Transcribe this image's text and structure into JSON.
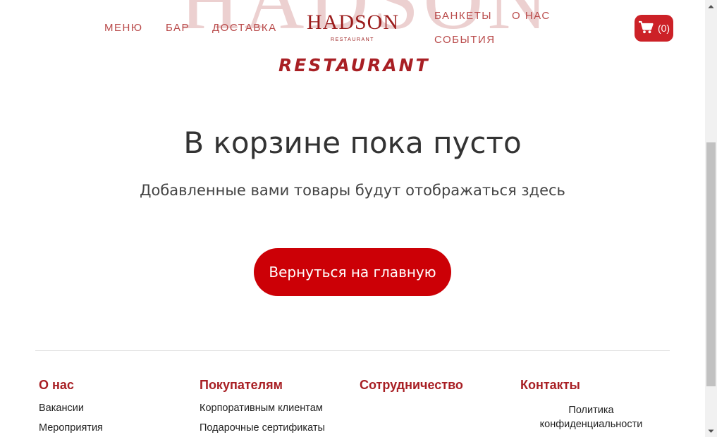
{
  "header": {
    "watermark_text": "HADSON",
    "nav_left": [
      "МЕНЮ",
      "БАР",
      "ДОСТАВКА"
    ],
    "nav_right": [
      "БАНКЕТЫ",
      "О НАС",
      "СОБЫТИЯ"
    ],
    "logo_main": "HADSON",
    "logo_sub": "RESTAURANT",
    "restaurant_word": "RESTAURANT",
    "cart_icon": "cart-icon",
    "cart_count": "(0)"
  },
  "main": {
    "title": "В корзине пока пусто",
    "subtitle": "Добавленные вами товары будут отображаться здесь",
    "home_button": "Вернуться на главную"
  },
  "footer": {
    "columns": [
      {
        "heading": "О нас",
        "links": [
          "Вакансии",
          "Мероприятия"
        ]
      },
      {
        "heading": "Покупателям",
        "links": [
          "Корпоративным клиентам",
          "Подарочные сертификаты"
        ]
      },
      {
        "heading": "Сотрудничество",
        "links": []
      },
      {
        "heading": "Контакты",
        "links": []
      }
    ],
    "policy_line1": "Политика",
    "policy_line2": "конфиденциальности"
  },
  "colors": {
    "accent": "#cc0006",
    "brand": "#a81f24",
    "nav_text": "#b94a4a",
    "watermark": "#ecd0d0"
  }
}
